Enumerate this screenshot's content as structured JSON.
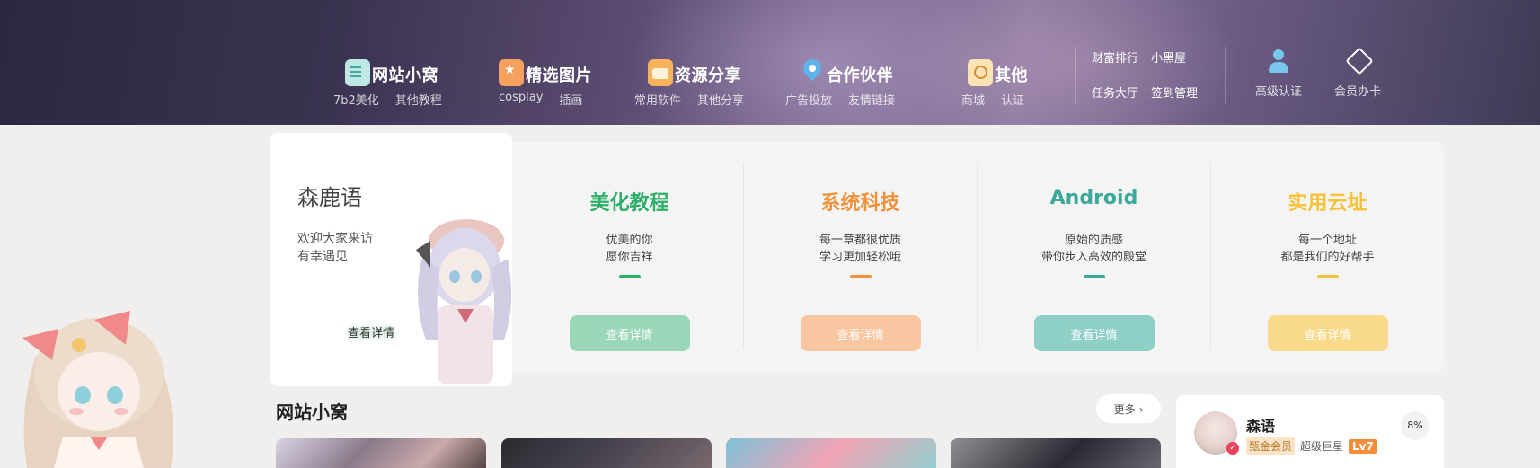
{
  "header": {
    "nav": [
      {
        "label": "网站小窝",
        "icon": "document-icon",
        "subs": [
          "7b2美化",
          "其他教程"
        ]
      },
      {
        "label": "精选图片",
        "icon": "star-bookmark-icon",
        "subs": [
          "cosplay",
          "插画"
        ]
      },
      {
        "label": "资源分享",
        "icon": "briefcase-icon",
        "subs": [
          "常用软件",
          "其他分享"
        ]
      },
      {
        "label": "合作伙伴",
        "icon": "location-pin-icon",
        "subs": [
          "广告投放",
          "友情链接"
        ]
      },
      {
        "label": "其他",
        "icon": "search-note-icon",
        "subs": [
          "商城",
          "认证"
        ]
      }
    ],
    "quick_links": [
      [
        "财富排行",
        "小黑屋"
      ],
      [
        "任务大厅",
        "签到管理"
      ]
    ],
    "actions": [
      {
        "label": "高级认证",
        "icon": "user-icon"
      },
      {
        "label": "会员办卡",
        "icon": "diamond-icon"
      }
    ]
  },
  "intro": {
    "title": "森鹿语",
    "desc_line1": "欢迎大家来访",
    "desc_line2": "有幸遇见",
    "button": "查看详情"
  },
  "features": [
    {
      "title": "美化教程",
      "line1": "优美的你",
      "line2": "愿你吉祥",
      "button": "查看详情",
      "color": "#2fae6a",
      "btn_color": "#9ad7b8"
    },
    {
      "title": "系统科技",
      "line1": "每一章都很优质",
      "line2": "学习更加轻松哦",
      "button": "查看详情",
      "color": "#f0923a",
      "btn_color": "#f8c6a0"
    },
    {
      "title": "Android",
      "line1": "原始的质感",
      "line2": "带你步入高效的殿堂",
      "button": "查看详情",
      "color": "#3aa999",
      "btn_color": "#8fd0c6"
    },
    {
      "title": "实用云址",
      "line1": "每一个地址",
      "line2": "都是我们的好帮手",
      "button": "查看详情",
      "color": "#f7c23a",
      "btn_color": "#f9da8a"
    }
  ],
  "section": {
    "title": "网站小窝",
    "more": "更多"
  },
  "profile": {
    "name": "森语",
    "vip": "甄金会员",
    "rank": "超级巨星",
    "level": "Lv7",
    "progress": "8%"
  }
}
